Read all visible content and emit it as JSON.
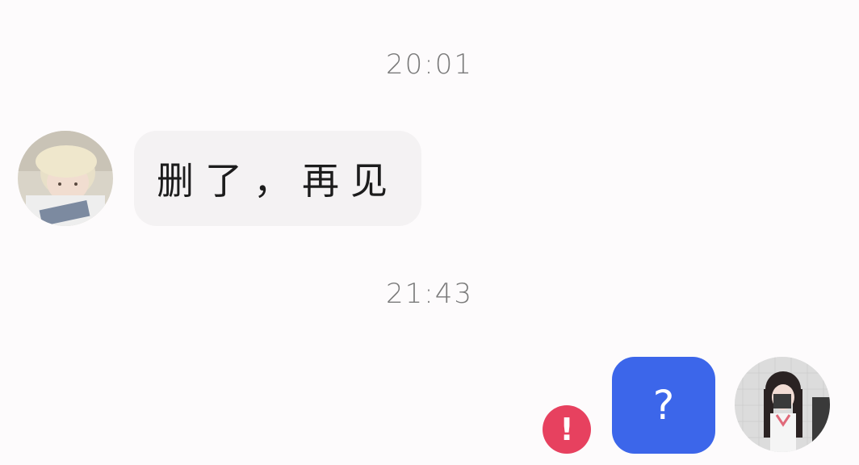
{
  "timestamps": [
    "20:01",
    "21:43"
  ],
  "messages": [
    {
      "side": "left",
      "text": "删了，再见"
    },
    {
      "side": "right",
      "text": "?",
      "status": "failed"
    }
  ],
  "icons": {
    "error": "!"
  },
  "colors": {
    "background": "#fdfbfc",
    "left_bubble": "#f4f2f3",
    "right_bubble": "#3c66ea",
    "error": "#e7415f"
  }
}
